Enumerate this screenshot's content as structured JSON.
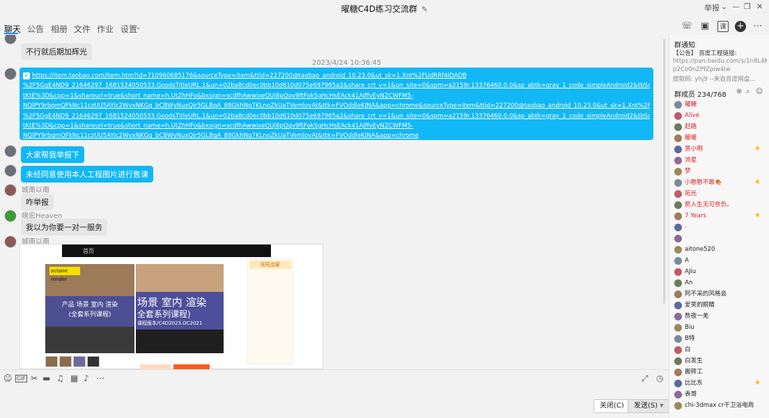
{
  "window": {
    "title": "曜糖C4D练习交流群",
    "controls": [
      "举报",
      "⌄",
      "—",
      "❐",
      "✕"
    ]
  },
  "tabs": [
    {
      "label": "聊天",
      "active": true
    },
    {
      "label": "公告"
    },
    {
      "label": "相册"
    },
    {
      "label": "文件"
    },
    {
      "label": "作业"
    },
    {
      "label": "设置"
    }
  ],
  "header_icons": [
    "phone-icon",
    "video-icon",
    "screen-share-icon",
    "add-icon",
    "more-icon"
  ],
  "chat": {
    "messages_top": [
      {
        "text": "不行就后期加辉光"
      }
    ],
    "timestamp": "2023/4/24 10:36:45",
    "link_lines": [
      "https://item.taobao.com/item.htm?id=710960685176&sourceType=item&ttid=227200@taobao_android_10.23.0&ut_sk=1.Xnt%2FUdRRf4IDADB",
      "%2F5GgE4ND9_21646297_1681524050533.GoodsTitleURL.1&un=02ba8cd0ec0bb10d610d075e697965a2&share_crt_v=1&un_site=0&spm=a2159r.13376460.0.0&sp_abtk=gray_1_code_simpleAndroid2&tbSocialPopKey=shareItem&sp_tk=RlYwZGRsZU",
      "tKtE%3D&cpp=1&shareurl=true&short_name=h.UtZhHFo&bxsign=scdfhAwwixeQUj8pQqv9ftFokSgHcHsEAck41AJffvEyNZCWFM5-",
      "NQlPY9rbqmQFkNc11czUU5AYic2WvxNKGq_bCBWyNuxQjr5GLBqA_88GkhNg7KLnoZkUaTVemlovAt&ttk=FVOddleKJNA&app=chrome&sourceType=item&ttid=227200@taobao_android_10.23.0&ut_sk=1.Xnt%2FUdRRf4IDADB",
      "%2F5GgE4ND9_21646297_1681524050533.GoodsTitleURL.1&un=02ba8cd0ec0bb10d610d075e697965a2&share_crt_v=1&un_site=0&spm=a2159r.13376460.0.0&sp_abtk=gray_1_code_simpleAndroid2&tbSocialPopKey=shareItem&sp_tk=RlYwZGRsZU",
      "tKtE%3D&cpp=1&shareurl=true&short_name=h.UtZhHFo&bxsign=scdfhAwwixeQUj8pQqv9ftFokSgHcHsEAck41AJffvEyNZCWFM5-",
      "NQlPY9rbqmQFkNc11czUU5AYic2WvxNKGq_bCBWyNuxQjr5GLBqA_88GkhNg7KLnoZkUaTVemlovAt&ttk=FVOddleKJNA&app=chrome"
    ],
    "blue_msgs": [
      "大家帮我举报下",
      "未经同意使用本人工程图片进行售课"
    ],
    "nick_1": "城南以南",
    "msg_report": "咋举报",
    "nick_2": "晓宏Heaven",
    "msg_service": "我以为你要一对一服务",
    "nick_3": "城南以南",
    "screenshot": {
      "topbar": "首页",
      "brand": "octane render",
      "card1_line1": "产品 场景 室内 渲染",
      "card1_line2": "(全套系列课程)",
      "card2_big": "场景 室内 渲染",
      "card2_mid": "全套系列课程)",
      "card2_small": "课程版本/C4D2023.OC2021",
      "shop_header": "旺旺店家"
    }
  },
  "input_bar": {
    "tools": [
      "emoji-icon",
      "gif-icon",
      "scissors-icon",
      "folder-icon",
      "music-icon",
      "image-icon",
      "bell-icon",
      "more-icon"
    ],
    "close_label": "关闭(C)",
    "send_label": "发送(S)"
  },
  "right_panel": {
    "notice_title": "群通知",
    "notice_lines": [
      "【公告】 百度工程链接:",
      "https://pan.baidu.com/s/1n8L4KNb",
      "p2Co0nZPfZpiw4iw",
      "提取码: yhj9 --来自百度网盘..."
    ],
    "members_title": "群成员 234/768",
    "members": [
      {
        "name": "曜糖",
        "color": "#e02020"
      },
      {
        "name": "Alive",
        "color": "#e02020"
      },
      {
        "name": "赶路",
        "color": "#e02020"
      },
      {
        "name": "暖暖",
        "color": "#e02020"
      },
      {
        "name": "贾小明",
        "color": "#e02020",
        "star": true
      },
      {
        "name": "流星",
        "color": "#e02020"
      },
      {
        "name": "梦",
        "color": "#e02020"
      },
      {
        "name": "小憨憨不敢🍖",
        "color": "#e02020",
        "star": true
      },
      {
        "name": "拓光",
        "color": "#e02020"
      },
      {
        "name": "愿人生无可奈负。",
        "color": "#e02020"
      },
      {
        "name": "7 Years",
        "color": "#e02020",
        "star": true
      },
      {
        "name": "-",
        "color": "#e02020"
      },
      {
        "name": "",
        "color": "#222"
      },
      {
        "name": "aitone520",
        "color": "#222"
      },
      {
        "name": "A",
        "color": "#222"
      },
      {
        "name": "AJiu",
        "color": "#222"
      },
      {
        "name": "An",
        "color": "#222"
      },
      {
        "name": "阿不采的风格会",
        "color": "#222"
      },
      {
        "name": "爱笑的眼睛",
        "color": "#222"
      },
      {
        "name": "熬夜一羌",
        "color": "#222"
      },
      {
        "name": "Biu",
        "color": "#222"
      },
      {
        "name": "B特",
        "color": "#222"
      },
      {
        "name": "白",
        "color": "#222"
      },
      {
        "name": "白发生",
        "color": "#222"
      },
      {
        "name": "搬砖工",
        "color": "#222"
      },
      {
        "name": "比比东",
        "color": "#222",
        "star": true
      },
      {
        "name": "表哥",
        "color": "#222"
      },
      {
        "name": "chi-3dmax cr干卫浴电商渲染",
        "color": "#222"
      }
    ]
  }
}
